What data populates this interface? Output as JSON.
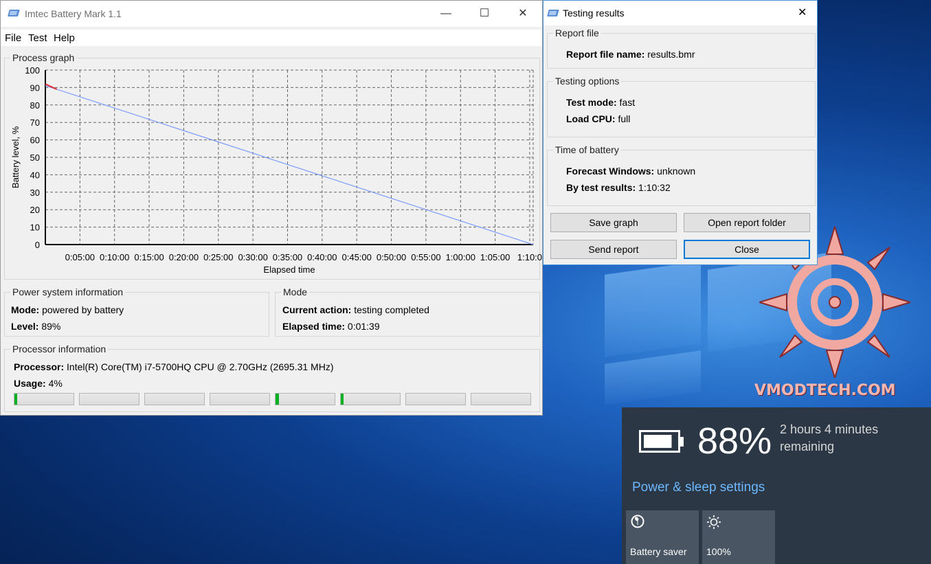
{
  "main_window": {
    "title": "Imtec Battery Mark 1.1",
    "controls": {
      "minimize": "—",
      "maximize": "☐",
      "close": "✕"
    },
    "menu": [
      "File",
      "Test",
      "Help"
    ],
    "graph": {
      "group_title": "Process graph",
      "ylabel": "Battery level, %",
      "xlabel": "Elapsed time",
      "yticks": [
        "100",
        "90",
        "80",
        "70",
        "60",
        "50",
        "40",
        "30",
        "20",
        "10",
        "0"
      ],
      "xticks": [
        "0:05:00",
        "0:10:00",
        "0:15:00",
        "0:20:00",
        "0:25:00",
        "0:30:00",
        "0:35:00",
        "0:40:00",
        "0:45:00",
        "0:50:00",
        "0:55:00",
        "1:00:00",
        "1:05:00",
        "1:10:0"
      ]
    },
    "power": {
      "group_title": "Power system information",
      "mode_label": "Mode:",
      "mode_value": "powered by battery",
      "level_label": "Level:",
      "level_value": "89%"
    },
    "mode": {
      "group_title": "Mode",
      "action_label": "Current action:",
      "action_value": "testing completed",
      "elapsed_label": "Elapsed time:",
      "elapsed_value": "0:01:39"
    },
    "processor": {
      "group_title": "Processor information",
      "proc_label": "Processor:",
      "proc_value": "Intel(R) Core(TM) i7-5700HQ CPU @ 2.70GHz  (2695.31 MHz)",
      "usage_label": "Usage:",
      "usage_value": "4%",
      "core_usage": [
        0.01,
        0,
        0,
        0,
        0.06,
        0.04,
        0,
        0
      ]
    }
  },
  "dialog": {
    "title": "Testing results",
    "close": "✕",
    "report_group": "Report file",
    "report_label": "Report file name:",
    "report_value": "results.bmr",
    "options_group": "Testing options",
    "test_mode_label": "Test mode:",
    "test_mode_value": "fast",
    "load_cpu_label": "Load CPU:",
    "load_cpu_value": "full",
    "time_group": "Time of battery",
    "forecast_label": "Forecast Windows:",
    "forecast_value": "unknown",
    "by_test_label": "By test results:",
    "by_test_value": "1:10:32",
    "buttons": {
      "save_graph": "Save graph",
      "open_folder": "Open report folder",
      "send_report": "Send report",
      "close": "Close"
    }
  },
  "battery_flyout": {
    "percent": "88%",
    "remaining_line1": "2 hours 4 minutes",
    "remaining_line2": "remaining",
    "settings_link": "Power & sleep settings",
    "tiles": [
      {
        "label": "Battery saver",
        "icon": "leaf-icon"
      },
      {
        "label": "100%",
        "icon": "brightness-icon"
      }
    ]
  },
  "watermark": "VMODTECH.COM",
  "chart_data": {
    "type": "line",
    "xlabel": "Elapsed time",
    "ylabel": "Battery level, %",
    "xlim": [
      0,
      70.5
    ],
    "ylim": [
      0,
      100
    ],
    "x_unit": "minutes",
    "series": [
      {
        "values": [
          [
            0,
            91
          ],
          [
            1.65,
            89
          ],
          [
            70.5,
            0
          ]
        ],
        "color": "#7b9cff"
      }
    ],
    "measured_segment": {
      "values": [
        [
          0,
          92
        ],
        [
          1.65,
          89
        ]
      ],
      "color": "#e0303a"
    },
    "grid": true
  }
}
